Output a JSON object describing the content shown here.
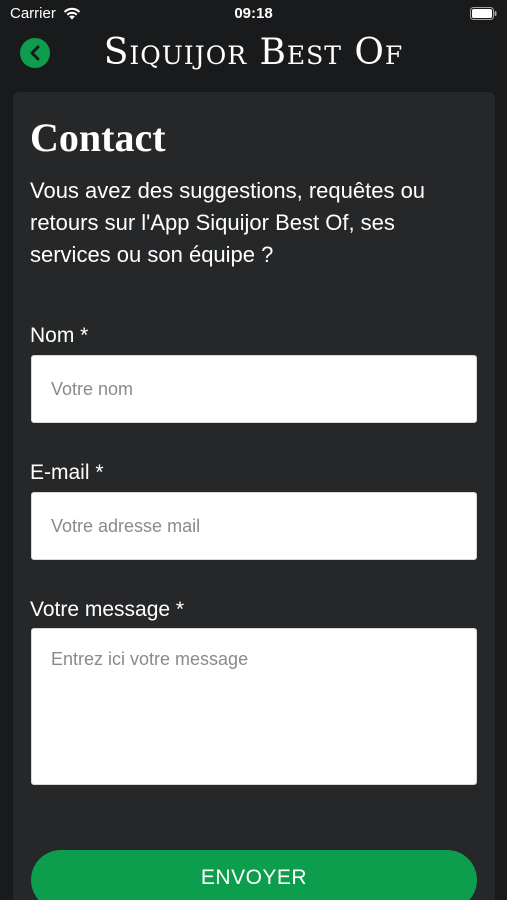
{
  "status_bar": {
    "carrier": "Carrier",
    "time": "09:18",
    "wifi_icon": "wifi-icon",
    "battery_icon": "battery-icon"
  },
  "header": {
    "title": "Siquijor Best Of",
    "back_icon": "chevron-left-icon",
    "accent_color": "#0c9d4d"
  },
  "contact": {
    "title": "Contact",
    "intro": "Vous avez des suggestions, requêtes ou retours sur l'App Siquijor Best Of, ses services ou son équipe ?"
  },
  "form": {
    "name": {
      "label": "Nom *",
      "placeholder": "Votre nom",
      "value": ""
    },
    "email": {
      "label": "E-mail *",
      "placeholder": "Votre adresse mail",
      "value": ""
    },
    "message": {
      "label": "Votre message *",
      "placeholder": "Entrez ici votre message",
      "value": ""
    },
    "submit_label": "ENVOYER"
  },
  "colors": {
    "background": "#191a1c",
    "card": "#262729",
    "accent": "#0c9d4d"
  }
}
